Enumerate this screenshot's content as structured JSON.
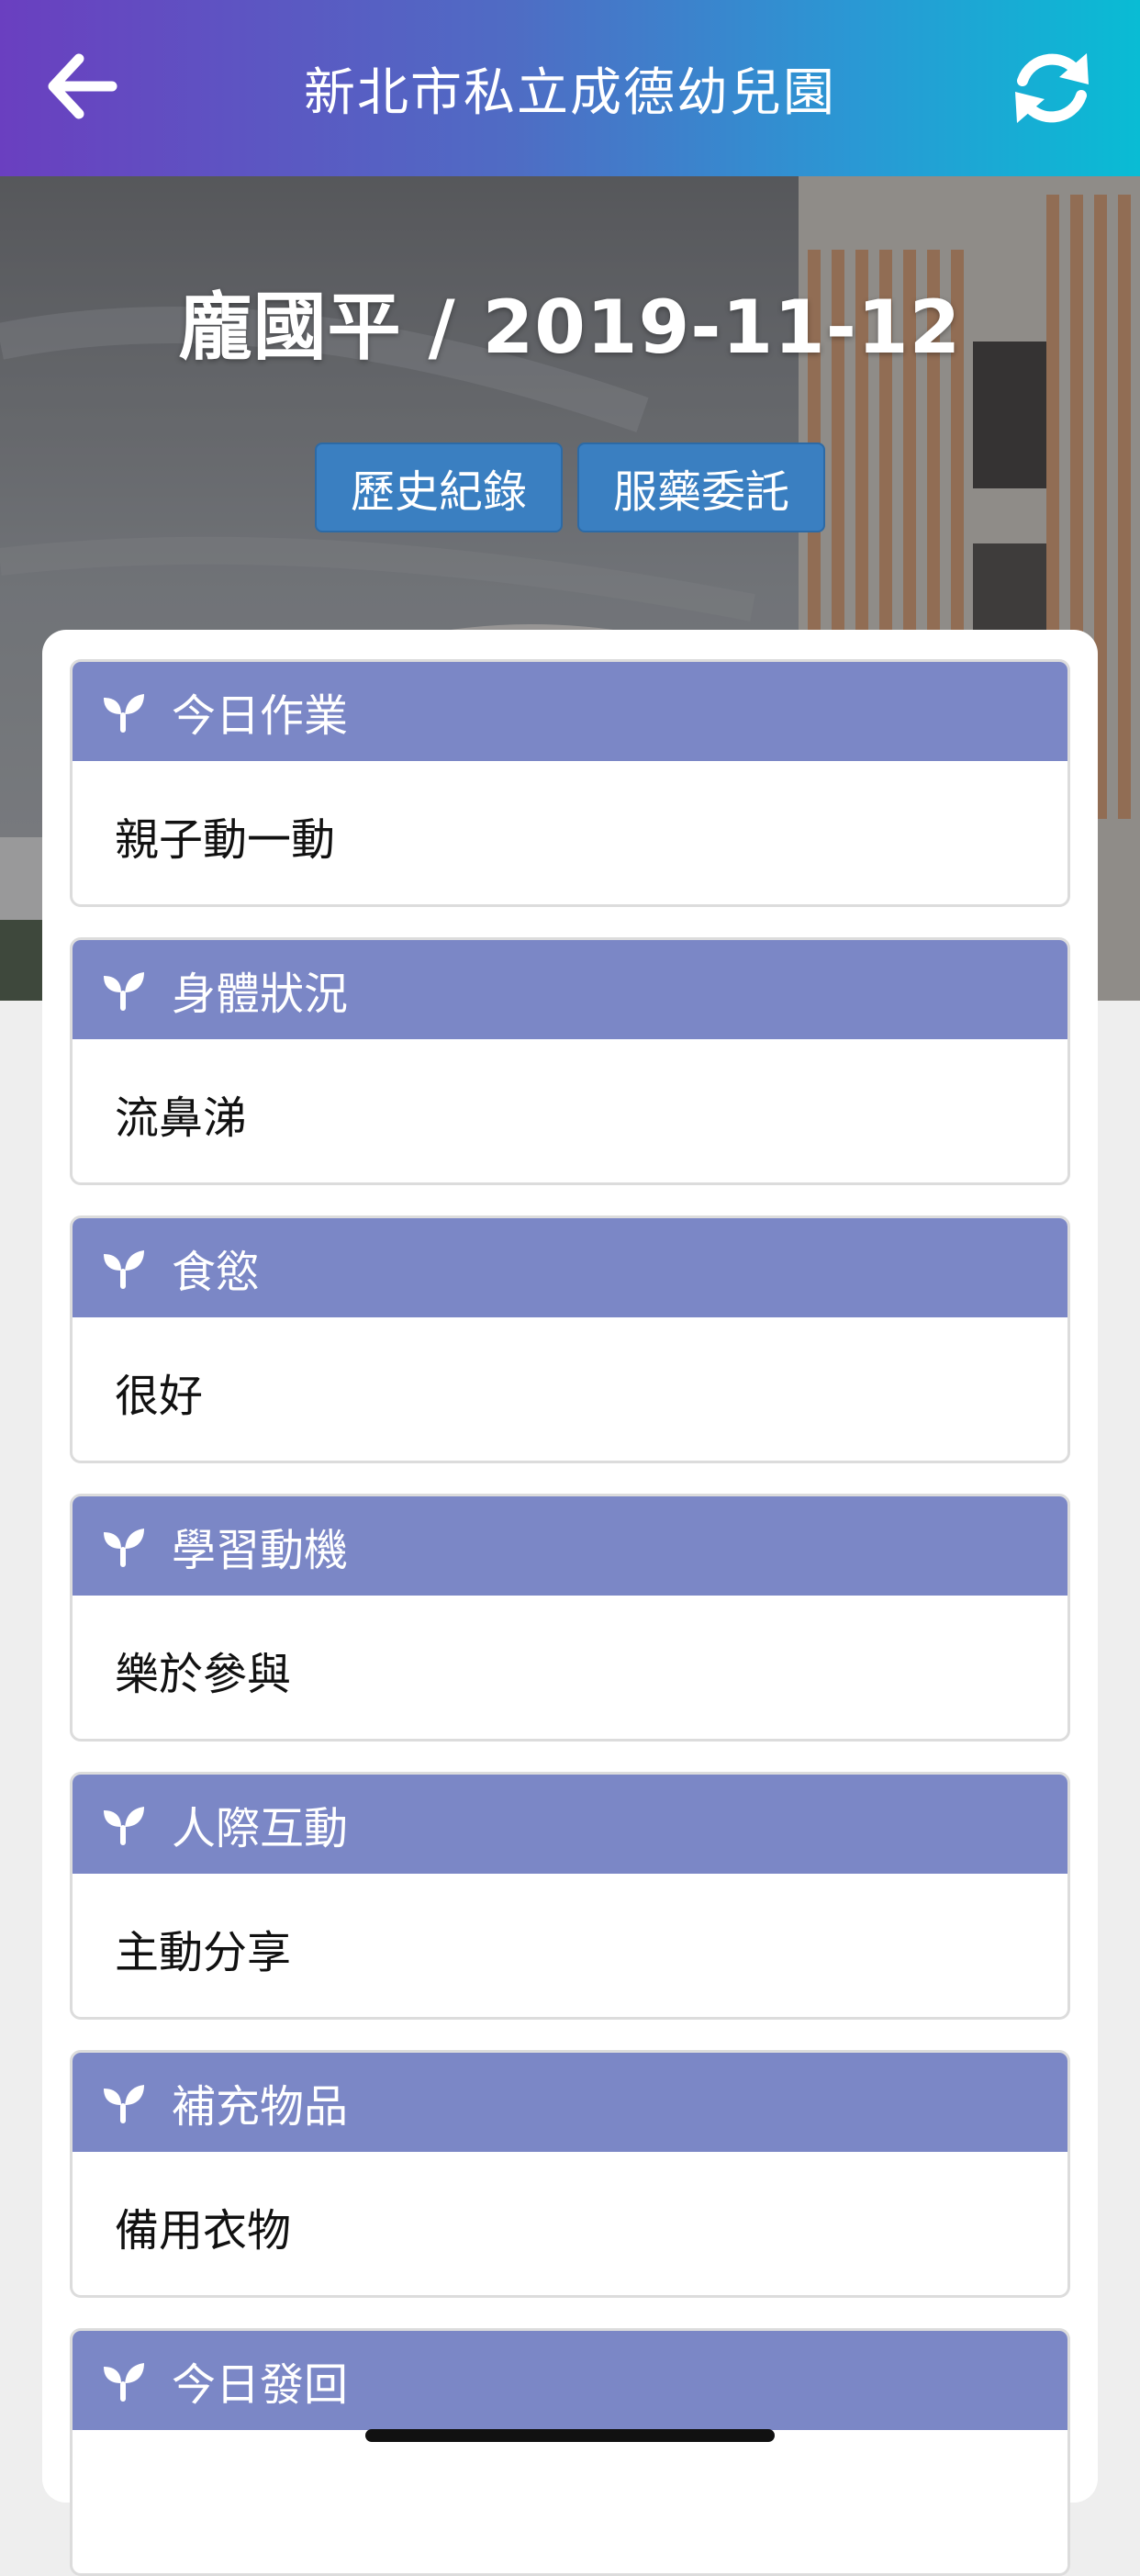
{
  "header": {
    "title": "新北市私立成德幼兒園",
    "back_icon": "arrow-left-icon",
    "refresh_icon": "refresh-icon",
    "gradient_colors": [
      "#6a3fc0",
      "#4f6cc4",
      "#2a98d4",
      "#09bcd4"
    ]
  },
  "hero": {
    "student_line": "龐國平 / 2019-11-12",
    "buttons": [
      {
        "label": "歷史紀錄"
      },
      {
        "label": "服藥委託"
      }
    ],
    "button_color": "#3a7fc1"
  },
  "sections": [
    {
      "title": "今日作業",
      "value": "親子動一動"
    },
    {
      "title": "身體狀況",
      "value": "流鼻涕"
    },
    {
      "title": "食慾",
      "value": "很好"
    },
    {
      "title": "學習動機",
      "value": "樂於參與"
    },
    {
      "title": "人際互動",
      "value": "主動分享"
    },
    {
      "title": "補充物品",
      "value": "備用衣物"
    },
    {
      "title": "今日發回",
      "value": ""
    }
  ],
  "section_header_color": "#7b87c6",
  "section_icon": "sprout-icon"
}
